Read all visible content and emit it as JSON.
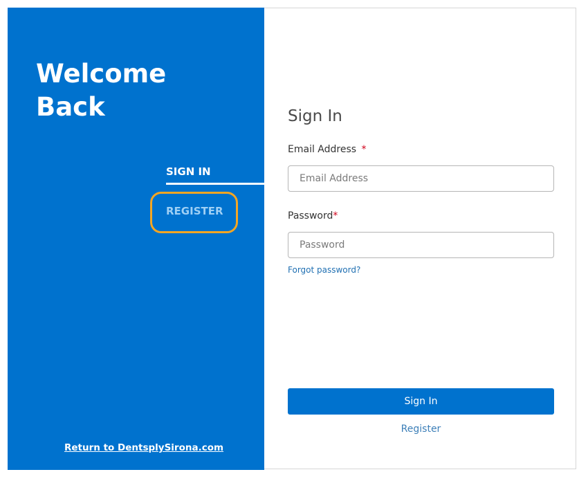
{
  "colors": {
    "brand_blue": "#0072ce",
    "highlight_orange": "#f5a623",
    "required_red": "#d0021b",
    "link_blue": "#1f6fb2"
  },
  "left_panel": {
    "welcome_line1": "Welcome",
    "welcome_line2": "Back",
    "tabs": {
      "signin": "SIGN IN",
      "register": "REGISTER"
    },
    "return_link": "Return to DentsplySirona.com"
  },
  "form": {
    "title": "Sign In",
    "email": {
      "label": "Email Address",
      "required_mark": "*",
      "placeholder": "Email Address",
      "value": ""
    },
    "password": {
      "label": "Password",
      "required_mark": "*",
      "placeholder": "Password",
      "value": ""
    },
    "forgot_password": "Forgot password?",
    "submit_label": "Sign In",
    "register_link": "Register"
  }
}
